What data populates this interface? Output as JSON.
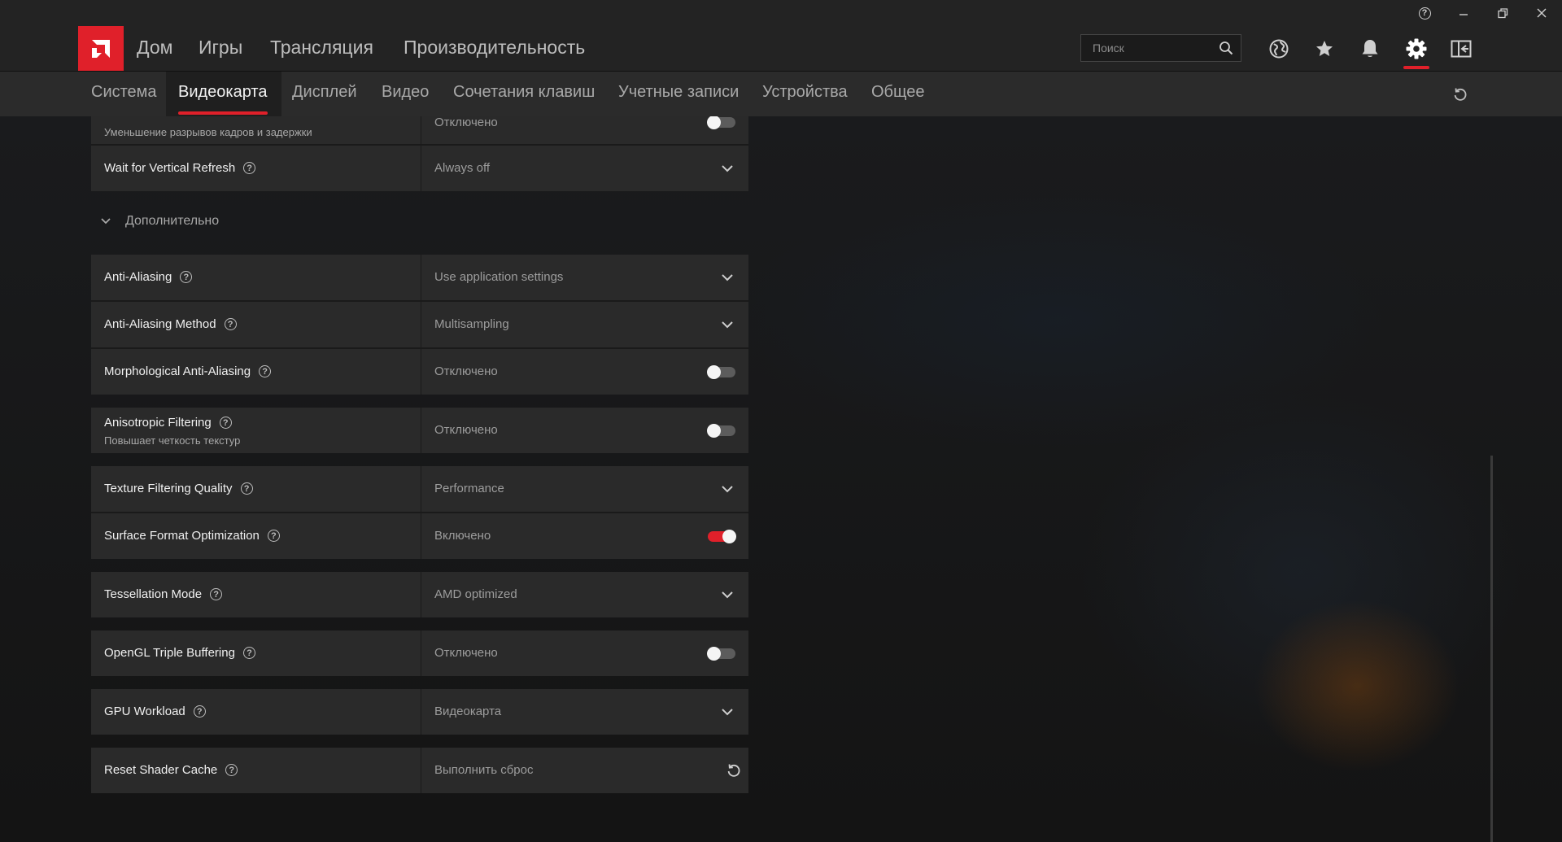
{
  "window": {
    "help": "?"
  },
  "nav": {
    "items": [
      "Дом",
      "Игры",
      "Трансляция",
      "Производительность"
    ],
    "search_placeholder": "Поиск"
  },
  "tabs": [
    "Система",
    "Видеокарта",
    "Дисплей",
    "Видео",
    "Сочетания клавиш",
    "Учетные записи",
    "Устройства",
    "Общее"
  ],
  "active_tab": "Видеокарта",
  "top_partial": {
    "subtitle": "Уменьшение разрывов кадров и задержки",
    "value": "Отключено",
    "toggle_on": false
  },
  "vsync": {
    "label": "Wait for Vertical Refresh",
    "value": "Always off"
  },
  "section_label": "Дополнительно",
  "settings": [
    {
      "label": "Anti-Aliasing",
      "value": "Use application settings",
      "control": "dropdown"
    },
    {
      "label": "Anti-Aliasing Method",
      "value": "Multisampling",
      "control": "dropdown"
    },
    {
      "label": "Morphological Anti-Aliasing",
      "value": "Отключено",
      "control": "toggle",
      "on": false
    },
    {
      "label": "Anisotropic Filtering",
      "subtitle": "Повышает четкость текстур",
      "value": "Отключено",
      "control": "toggle",
      "on": false
    },
    {
      "label": "Texture Filtering Quality",
      "value": "Performance",
      "control": "dropdown"
    },
    {
      "label": "Surface Format Optimization",
      "value": "Включено",
      "control": "toggle",
      "on": true
    },
    {
      "label": "Tessellation Mode",
      "value": "AMD optimized",
      "control": "dropdown"
    },
    {
      "label": "OpenGL Triple Buffering",
      "value": "Отключено",
      "control": "toggle",
      "on": false
    },
    {
      "label": "GPU Workload",
      "value": "Видеокарта",
      "control": "dropdown"
    },
    {
      "label": "Reset Shader Cache",
      "value": "Выполнить сброс",
      "control": "reset"
    }
  ],
  "colors": {
    "accent": "#e0202a",
    "panel": "#2a2a2a",
    "topbar": "#232323",
    "subnav": "#2b2b2b"
  },
  "icons": [
    "amd-logo-icon",
    "search-icon",
    "globe-icon",
    "star-icon",
    "bell-icon",
    "gear-icon",
    "sidebar-panel-icon",
    "reset-icon",
    "chevron-down-icon",
    "help-icon",
    "minimize-icon",
    "restore-icon",
    "close-icon"
  ]
}
